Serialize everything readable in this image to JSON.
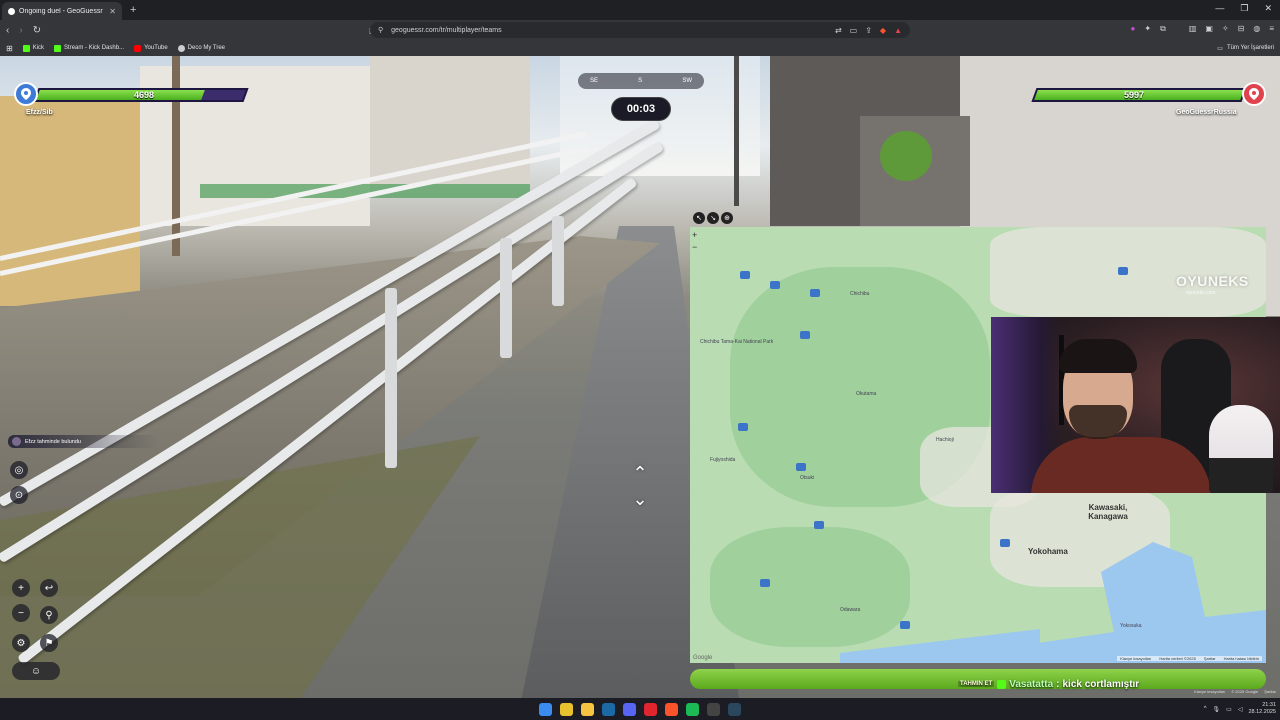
{
  "browser": {
    "tab_title": "Ongoing duel - GeoGuessr",
    "tab_close": "✕",
    "new_tab": "+",
    "url": "geoguessr.com/tr/multiplayer/teams",
    "bookmarks": [
      {
        "label": "Kick",
        "color": "#53fc18"
      },
      {
        "label": "Stream - Kick Dashb...",
        "color": "#53fc18"
      },
      {
        "label": "YouTube",
        "color": "#ff0000"
      },
      {
        "label": "Deco My Tree",
        "color": "#cccccc"
      }
    ],
    "all_bookmarks": "Tüm Yer İşaretleri"
  },
  "hud": {
    "left_player": {
      "name": "Efzz/Sib",
      "hp": "4698",
      "hp_fraction": 0.8,
      "accent": "#3d7bd6"
    },
    "right_player": {
      "name": "GeoGuessrRussia",
      "hp": "5997",
      "hp_fraction": 1.0,
      "accent": "#e0434d"
    },
    "compass": [
      "SE",
      "S",
      "SW"
    ],
    "timer": "00:03",
    "notification": "Efzz tahminde bulundu"
  },
  "map": {
    "labels": [
      {
        "text": "Chichibu",
        "big": false
      },
      {
        "text": "Chichibu Tama-Kai National Park",
        "big": false
      },
      {
        "text": "Okutama",
        "big": false
      },
      {
        "text": "Hachioji",
        "big": false
      },
      {
        "text": "Fujiyoshida",
        "big": false
      },
      {
        "text": "Kawasaki, Kanagawa",
        "big": true
      },
      {
        "text": "Yokohama",
        "big": true
      },
      {
        "text": "Yokosuka",
        "big": false
      },
      {
        "text": "Odawara",
        "big": false
      },
      {
        "text": "Otsuki",
        "big": false
      }
    ],
    "footer": [
      "Klavye kısayolları",
      "Harita verileri ©2025",
      "Şartlar",
      "Harita hatası bildirin"
    ],
    "google": "Google",
    "zoom_in": "+",
    "zoom_out": "−"
  },
  "stream": {
    "watermark": "OYUNEKS",
    "watermark_sub": "oyuneks.com",
    "chat": {
      "tag": "TAHMIN ET",
      "user": "Vasatatta",
      "separator": ":",
      "message": "kick cortlamıştır"
    },
    "bottom_links": [
      "Klavye kısayolları",
      "© 2025 Google",
      "Şartlar"
    ]
  },
  "taskbar": {
    "time": "21:31",
    "date": "28.12.2025",
    "apps": [
      {
        "name": "windows",
        "color": "#3b8cf0"
      },
      {
        "name": "chrome",
        "color": "#e8c12f"
      },
      {
        "name": "explorer",
        "color": "#f5c542"
      },
      {
        "name": "steam",
        "color": "#1b6aa5"
      },
      {
        "name": "discord",
        "color": "#5865f2"
      },
      {
        "name": "opera",
        "color": "#e0252e"
      },
      {
        "name": "brave",
        "color": "#fb542b"
      },
      {
        "name": "spotify",
        "color": "#1db954"
      },
      {
        "name": "obs",
        "color": "#444"
      },
      {
        "name": "steam2",
        "color": "#2a475e"
      }
    ]
  }
}
